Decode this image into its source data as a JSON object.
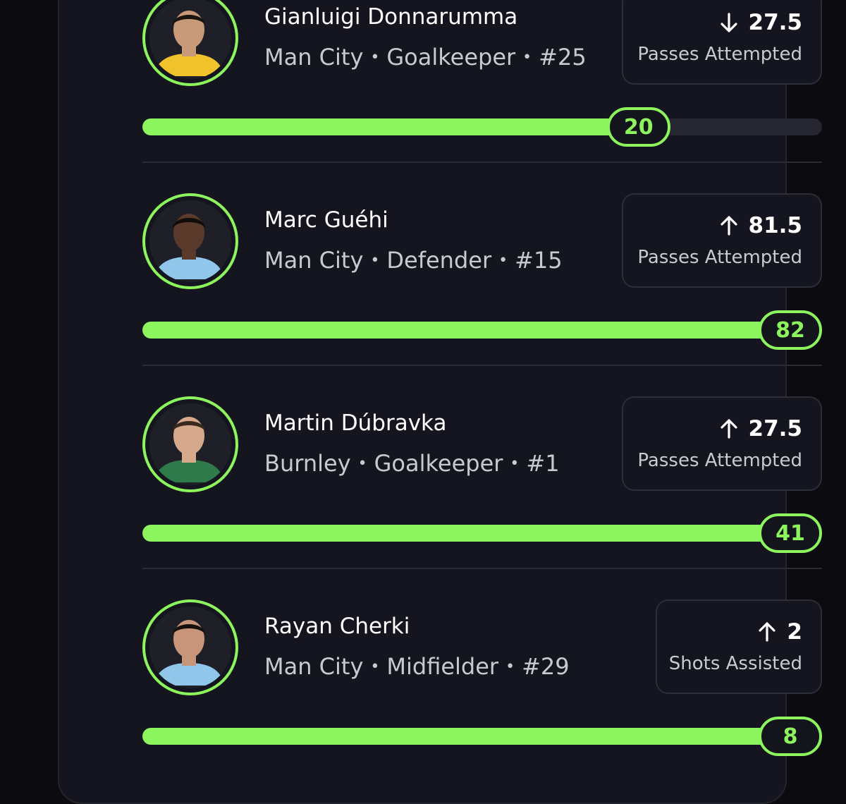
{
  "players": [
    {
      "name": "Gianluigi Donnarumma",
      "team": "Man City",
      "position": "Goalkeeper",
      "number": "#25",
      "direction": "down",
      "line": "27.5",
      "stat": "Passes Attempted",
      "bar_value": "20",
      "bar_fraction": 0.73,
      "shirt_color": "#f0c22b",
      "skin_color": "#c99a7a",
      "hair_color": "#1b1410"
    },
    {
      "name": "Marc Guéhi",
      "team": "Man City",
      "position": "Defender",
      "number": "#15",
      "direction": "up",
      "line": "81.5",
      "stat": "Passes Attempted",
      "bar_value": "82",
      "bar_fraction": 1.0,
      "shirt_color": "#8fc6ea",
      "skin_color": "#5a3a2a",
      "hair_color": "#120c08"
    },
    {
      "name": "Martin Dúbravka",
      "team": "Burnley",
      "position": "Goalkeeper",
      "number": "#1",
      "direction": "up",
      "line": "27.5",
      "stat": "Passes Attempted",
      "bar_value": "41",
      "bar_fraction": 1.0,
      "shirt_color": "#2f7a4a",
      "skin_color": "#d7a98c",
      "hair_color": "#3a2a1e"
    },
    {
      "name": "Rayan Cherki",
      "team": "Man City",
      "position": "Midfielder",
      "number": "#29",
      "direction": "up",
      "line": "2",
      "stat": "Shots Assisted",
      "bar_value": "8",
      "bar_fraction": 1.0,
      "shirt_color": "#8fc6ea",
      "skin_color": "#c8957a",
      "hair_color": "#17110d"
    }
  ],
  "colors": {
    "accent": "#8cf45c",
    "background": "#0b0b10",
    "card": "#15151f"
  },
  "icons": {
    "down": "arrow-down-icon",
    "up": "arrow-up-icon"
  }
}
